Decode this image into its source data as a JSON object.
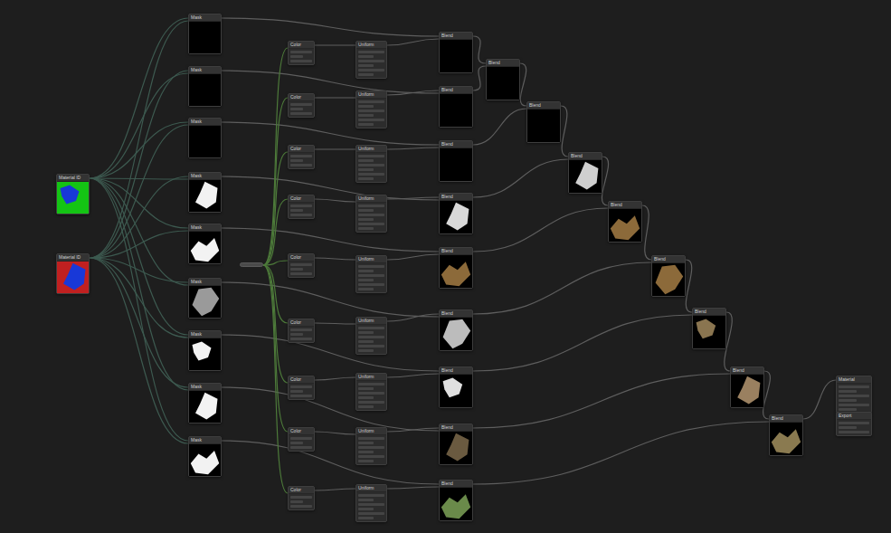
{
  "graph": {
    "nodes": [
      {
        "title": "Material ID",
        "kind": "source",
        "color": "#14c414"
      },
      {
        "title": "Material ID",
        "kind": "source",
        "color": "#c02020"
      },
      {
        "title": "Mask",
        "kind": "preview",
        "color": "#000000"
      },
      {
        "title": "Mask",
        "kind": "preview",
        "color": "#000000"
      },
      {
        "title": "Mask",
        "kind": "preview",
        "color": "#000000"
      },
      {
        "title": "Mask",
        "kind": "preview",
        "color": "#f2f2f2"
      },
      {
        "title": "Mask",
        "kind": "preview",
        "color": "#f2f2f2"
      },
      {
        "title": "Mask",
        "kind": "preview",
        "color": "#9a9a9a"
      },
      {
        "title": "Mask",
        "kind": "preview",
        "color": "#f2f2f2"
      },
      {
        "title": "Mask",
        "kind": "preview",
        "color": "#f2f2f2"
      },
      {
        "title": "Mask",
        "kind": "preview",
        "color": "#f2f2f2"
      },
      {
        "kind": "pill"
      },
      {
        "title": "Color",
        "kind": "small"
      },
      {
        "title": "Color",
        "kind": "small"
      },
      {
        "title": "Color",
        "kind": "small"
      },
      {
        "title": "Color",
        "kind": "small"
      },
      {
        "title": "Color",
        "kind": "small"
      },
      {
        "title": "Color",
        "kind": "small"
      },
      {
        "title": "Color",
        "kind": "small"
      },
      {
        "title": "Color",
        "kind": "small"
      },
      {
        "title": "Color",
        "kind": "small"
      },
      {
        "title": "Uniform",
        "kind": "params"
      },
      {
        "title": "Uniform",
        "kind": "params"
      },
      {
        "title": "Uniform",
        "kind": "params"
      },
      {
        "title": "Uniform",
        "kind": "params"
      },
      {
        "title": "Uniform",
        "kind": "params"
      },
      {
        "title": "Uniform",
        "kind": "params"
      },
      {
        "title": "Uniform",
        "kind": "params"
      },
      {
        "title": "Uniform",
        "kind": "params"
      },
      {
        "title": "Uniform",
        "kind": "params"
      },
      {
        "title": "Blend",
        "kind": "preview",
        "color": "#000000"
      },
      {
        "title": "Blend",
        "kind": "preview",
        "color": "#000000"
      },
      {
        "title": "Blend",
        "kind": "preview",
        "color": "#000000"
      },
      {
        "title": "Blend",
        "kind": "preview",
        "color": "#d8d8d8"
      },
      {
        "title": "Blend",
        "kind": "preview",
        "color": "#8c6a3a"
      },
      {
        "title": "Blend",
        "kind": "preview",
        "color": "#bcbcbc"
      },
      {
        "title": "Blend",
        "kind": "preview",
        "color": "#e0e0e0"
      },
      {
        "title": "Blend",
        "kind": "preview",
        "color": "#6a5a40"
      },
      {
        "title": "Blend",
        "kind": "preview",
        "color": "#6a8a4a"
      },
      {
        "title": "Blend",
        "kind": "preview",
        "color": "#000000"
      },
      {
        "title": "Blend",
        "kind": "preview",
        "color": "#000000"
      },
      {
        "title": "Blend",
        "kind": "preview",
        "color": "#cfcfcf"
      },
      {
        "title": "Blend",
        "kind": "preview",
        "color": "#8c6a3a"
      },
      {
        "title": "Blend",
        "kind": "preview",
        "color": "#8c6a3a"
      },
      {
        "title": "Blend",
        "kind": "preview",
        "color": "#8a7550"
      },
      {
        "title": "Blend",
        "kind": "preview",
        "color": "#9a8060"
      },
      {
        "title": "Blend",
        "kind": "preview",
        "color": "#8a7a50"
      },
      {
        "title": "Material",
        "kind": "params"
      },
      {
        "title": "Export",
        "kind": "small"
      }
    ],
    "edges": [
      [
        0,
        2
      ],
      [
        0,
        3
      ],
      [
        0,
        4
      ],
      [
        0,
        5
      ],
      [
        0,
        6
      ],
      [
        0,
        7
      ],
      [
        0,
        8
      ],
      [
        0,
        9
      ],
      [
        0,
        10
      ],
      [
        1,
        2
      ],
      [
        1,
        3
      ],
      [
        1,
        4
      ],
      [
        1,
        5
      ],
      [
        1,
        6
      ],
      [
        1,
        7
      ],
      [
        1,
        8
      ],
      [
        1,
        9
      ],
      [
        1,
        10
      ],
      [
        2,
        30
      ],
      [
        3,
        31
      ],
      [
        4,
        32
      ],
      [
        5,
        33
      ],
      [
        6,
        34
      ],
      [
        7,
        35
      ],
      [
        8,
        36
      ],
      [
        9,
        37
      ],
      [
        10,
        38
      ],
      [
        11,
        12
      ],
      [
        11,
        13
      ],
      [
        11,
        14
      ],
      [
        11,
        15
      ],
      [
        11,
        16
      ],
      [
        11,
        17
      ],
      [
        11,
        18
      ],
      [
        11,
        19
      ],
      [
        11,
        20
      ],
      [
        12,
        21
      ],
      [
        13,
        22
      ],
      [
        14,
        23
      ],
      [
        15,
        24
      ],
      [
        16,
        25
      ],
      [
        17,
        26
      ],
      [
        18,
        27
      ],
      [
        19,
        28
      ],
      [
        20,
        29
      ],
      [
        21,
        30
      ],
      [
        22,
        31
      ],
      [
        23,
        32
      ],
      [
        24,
        33
      ],
      [
        25,
        34
      ],
      [
        26,
        35
      ],
      [
        27,
        36
      ],
      [
        28,
        37
      ],
      [
        29,
        38
      ],
      [
        30,
        39
      ],
      [
        31,
        39
      ],
      [
        39,
        40
      ],
      [
        32,
        40
      ],
      [
        40,
        41
      ],
      [
        33,
        41
      ],
      [
        41,
        42
      ],
      [
        34,
        42
      ],
      [
        42,
        43
      ],
      [
        35,
        43
      ],
      [
        43,
        44
      ],
      [
        36,
        44
      ],
      [
        44,
        45
      ],
      [
        37,
        45
      ],
      [
        45,
        46
      ],
      [
        38,
        46
      ],
      [
        46,
        47
      ],
      [
        47,
        48
      ]
    ]
  }
}
